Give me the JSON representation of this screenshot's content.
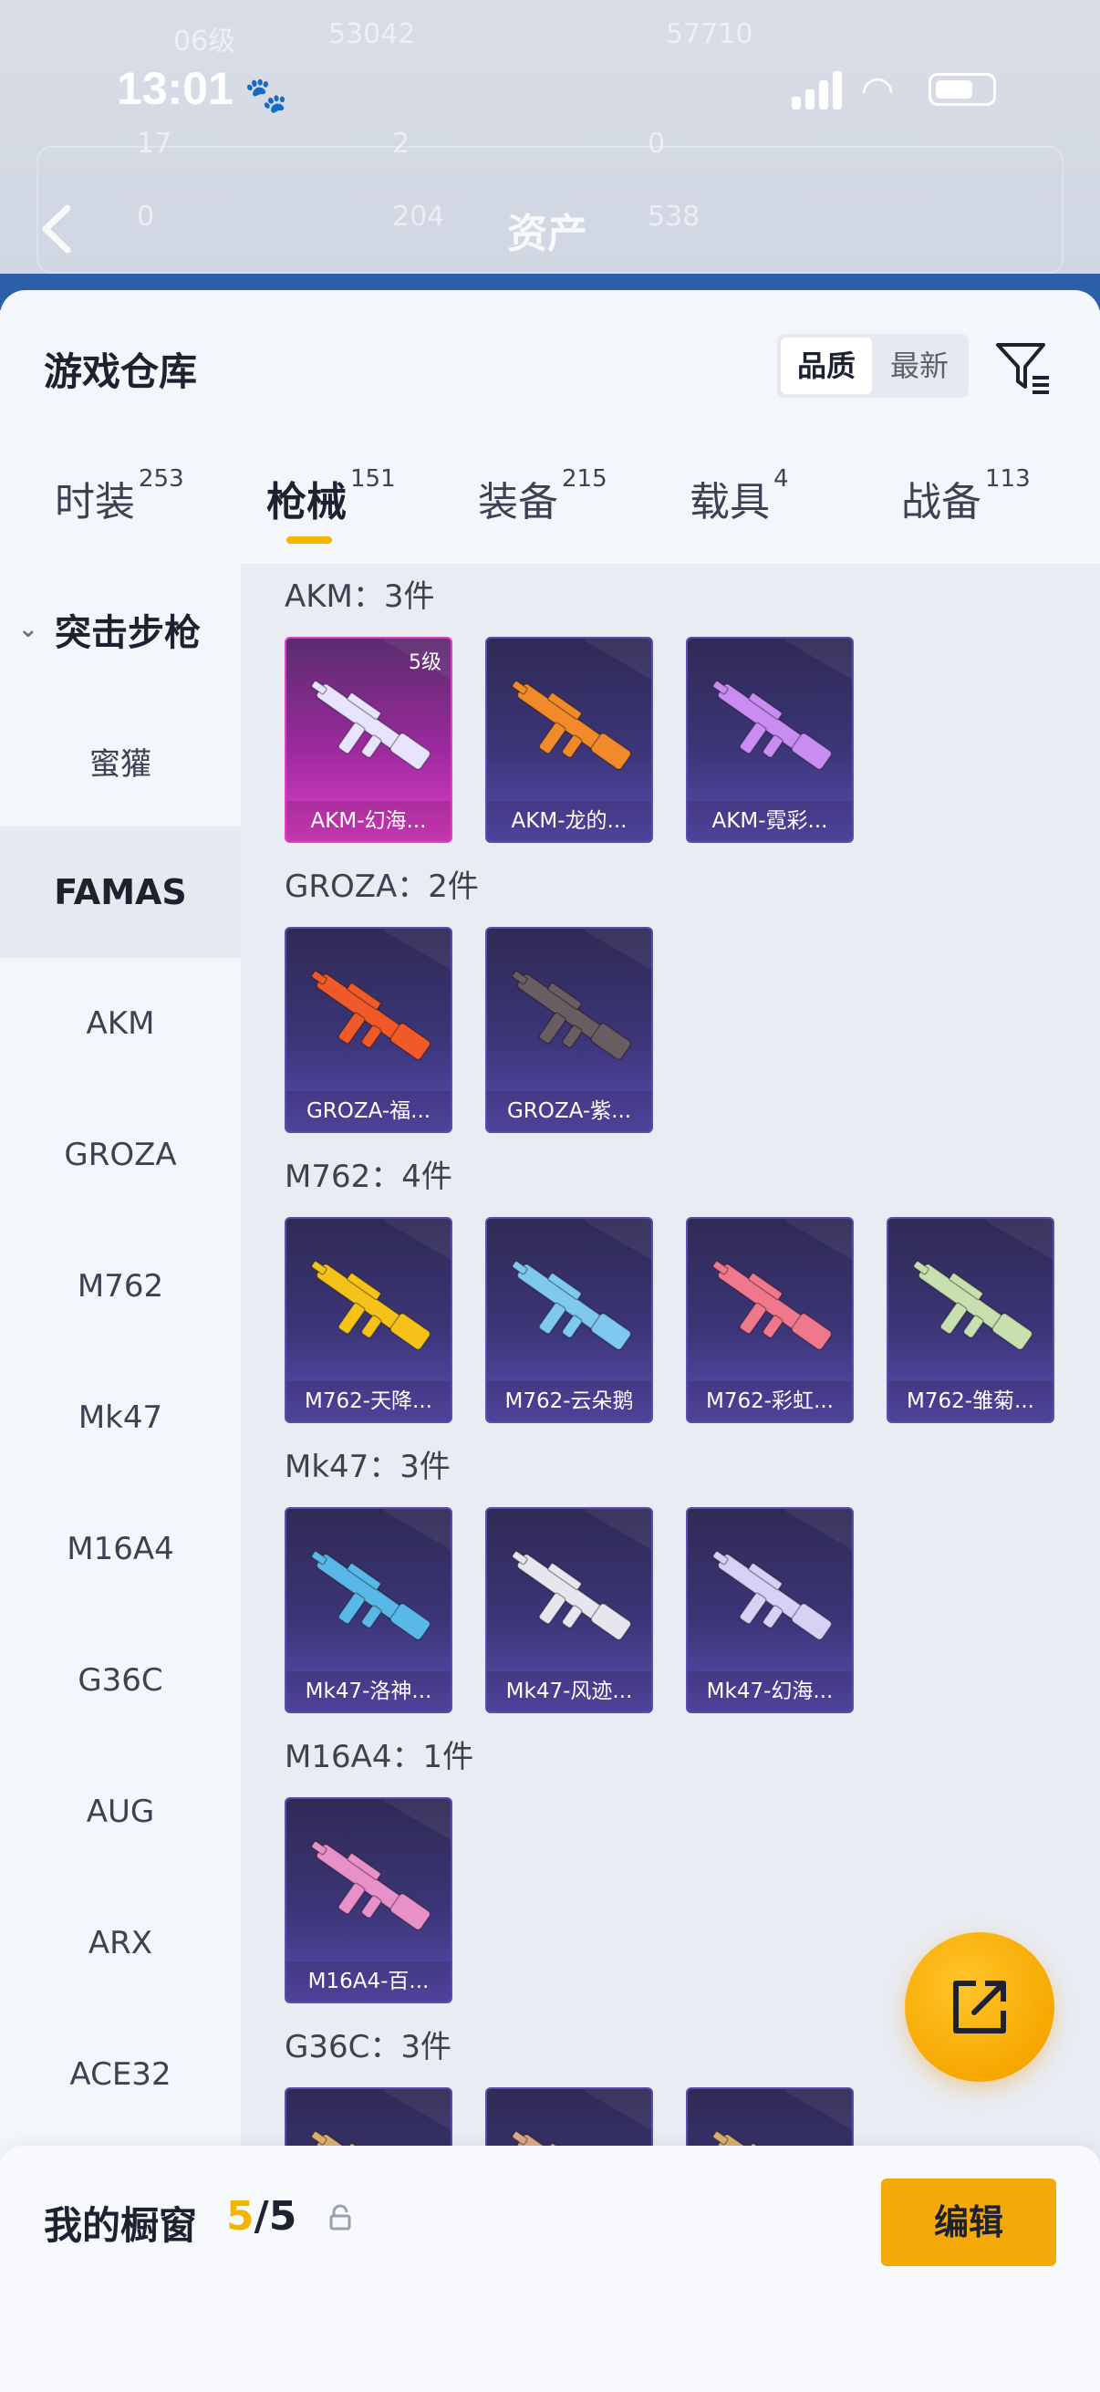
{
  "status_bar": {
    "time": "13:01"
  },
  "background_header": {
    "title": "资产",
    "ghost_row1": [
      "06级",
      "53042",
      "57710"
    ],
    "ghost_row2": [
      "17",
      "2",
      "0"
    ],
    "ghost_row3": [
      "0",
      "204",
      "538"
    ]
  },
  "sheet": {
    "title": "游戏仓库",
    "sort_options": [
      "品质",
      "最新"
    ],
    "sort_selected": "品质"
  },
  "category_tabs": [
    {
      "label": "时装",
      "count": "253"
    },
    {
      "label": "枪械",
      "count": "151"
    },
    {
      "label": "装备",
      "count": "215"
    },
    {
      "label": "载具",
      "count": "4"
    },
    {
      "label": "战备",
      "count": "113"
    }
  ],
  "category_selected": "枪械",
  "sidebar": {
    "group": "突击步枪",
    "items": [
      "蜜獾",
      "FAMAS",
      "AKM",
      "GROZA",
      "M762",
      "Mk47",
      "M16A4",
      "G36C",
      "AUG",
      "ARX",
      "ACE32"
    ],
    "selected": "FAMAS"
  },
  "sections": [
    {
      "title": "AKM：3件",
      "items": [
        {
          "name": "AKM-幻海...",
          "level": "5级",
          "color": "#e8e4ff"
        },
        {
          "name": "AKM-龙的...",
          "color": "#f08a2a"
        },
        {
          "name": "AKM-霓彩...",
          "color": "#c98cf0"
        }
      ]
    },
    {
      "title": "GROZA：2件",
      "items": [
        {
          "name": "GROZA-福...",
          "color": "#f05a28"
        },
        {
          "name": "GROZA-紫...",
          "color": "#6a5d62"
        }
      ]
    },
    {
      "title": "M762：4件",
      "items": [
        {
          "name": "M762-天降...",
          "color": "#f5c21a"
        },
        {
          "name": "M762-云朵鹅",
          "color": "#7fc8f0"
        },
        {
          "name": "M762-彩虹...",
          "color": "#f0788c"
        },
        {
          "name": "M762-雏菊...",
          "color": "#c8e0b0"
        }
      ]
    },
    {
      "title": "Mk47：3件",
      "items": [
        {
          "name": "Mk47-洛神...",
          "color": "#5ab8e8"
        },
        {
          "name": "Mk47-风迹...",
          "color": "#e6e6ee"
        },
        {
          "name": "Mk47-幻海...",
          "color": "#d8d0f5"
        }
      ]
    },
    {
      "title": "M16A4：1件",
      "items": [
        {
          "name": "M16A4-百...",
          "color": "#e890c8"
        }
      ]
    },
    {
      "title": "G36C：3件",
      "items": [
        {
          "name": "",
          "color": "#e0b070"
        },
        {
          "name": "",
          "color": "#e0a888"
        },
        {
          "name": "",
          "color": "#d8b070"
        }
      ]
    }
  ],
  "showcase": {
    "label": "我的橱窗",
    "current": "5",
    "separator": "/",
    "max": "5",
    "edit_label": "编辑"
  },
  "colors": {
    "accent": "#f5b400",
    "card_purple": "#3c3578",
    "card_rare": "#e03ec6"
  },
  "icons": [
    "back-chevron-icon",
    "filter-icon",
    "chevron-down-icon",
    "share-icon",
    "lock-icon",
    "paw-icon",
    "signal-icon",
    "wifi-icon",
    "battery-icon"
  ]
}
